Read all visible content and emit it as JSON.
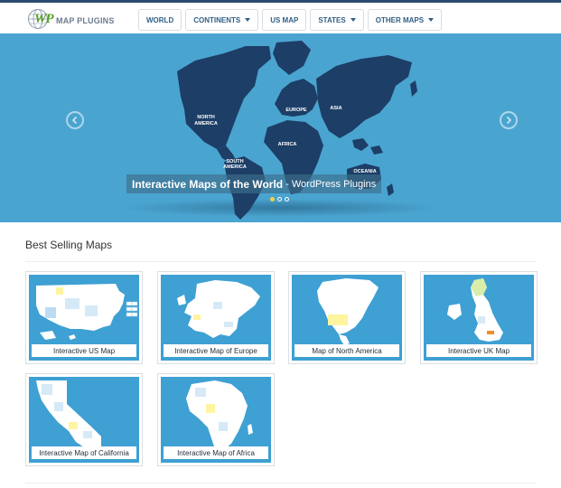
{
  "header": {
    "logo_mark": "WP",
    "logo_text": "MAP PLUGINS",
    "nav": [
      {
        "label": "WORLD",
        "dropdown": false
      },
      {
        "label": "CONTINENTS",
        "dropdown": true
      },
      {
        "label": "US MAP",
        "dropdown": false
      },
      {
        "label": "STATES",
        "dropdown": true
      },
      {
        "label": "OTHER MAPS",
        "dropdown": true
      }
    ]
  },
  "hero": {
    "title": "Interactive Maps of the World",
    "subtitle": "- WordPress Plugins",
    "map_labels": {
      "north_america": "NORTH\nAMERICA",
      "europe": "EUROPE",
      "asia": "ASIA",
      "africa": "AFRICA",
      "south_america": "SOUTH\nAMERICA",
      "oceania": "OCEANIA"
    },
    "slides": 3,
    "active_slide": 1
  },
  "best_selling": {
    "title": "Best Selling Maps",
    "cards": [
      {
        "label": "Interactive US Map"
      },
      {
        "label": "Interactive Map of Europe"
      },
      {
        "label": "Map of North America"
      },
      {
        "label": "Interactive UK Map"
      },
      {
        "label": "Interactive Map of California"
      },
      {
        "label": "Interactive Map of Africa"
      }
    ]
  },
  "colors": {
    "hero_bg": "#4aa4d0",
    "continent": "#1d3e66",
    "card_bg": "#3ea0d3",
    "nav_text": "#2f5f86",
    "dot_active": "#f0d34a"
  }
}
